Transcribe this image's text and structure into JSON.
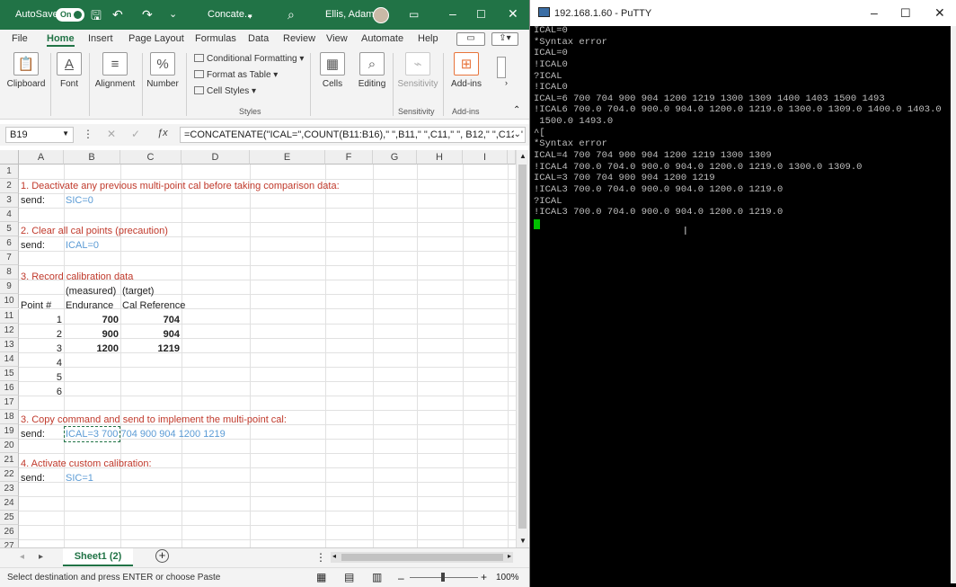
{
  "excel": {
    "titlebar": {
      "autosave_label": "AutoSave",
      "autosave_state": "On",
      "filename": "Concate...",
      "user": "Ellis, Adam"
    },
    "menu": [
      "File",
      "Home",
      "Insert",
      "Page Layout",
      "Formulas",
      "Data",
      "Review",
      "View",
      "Automate",
      "Help"
    ],
    "ribbon": {
      "clipboard": "Clipboard",
      "font": "Font",
      "alignment": "Alignment",
      "number": "Number",
      "cond_format": "Conditional Formatting",
      "format_table": "Format as Table",
      "cell_styles": "Cell Styles",
      "styles_group": "Styles",
      "cells": "Cells",
      "editing": "Editing",
      "sensitivity": "Sensitivity",
      "sensitivity_group": "Sensitivity",
      "addins": "Add-ins",
      "addins_group": "Add-ins"
    },
    "formula_bar": {
      "name_box": "B19",
      "formula": "=CONCATENATE(\"ICAL=\",COUNT(B11:B16),\" \",B11,\" \",C11,\" \", B12,\" \",C12,\""
    },
    "columns": [
      "A",
      "B",
      "C",
      "D",
      "E",
      "F",
      "G",
      "H",
      "I"
    ],
    "rows": [
      "1",
      "2",
      "3",
      "4",
      "5",
      "6",
      "7",
      "8",
      "9",
      "10",
      "11",
      "12",
      "13",
      "14",
      "15",
      "16",
      "17",
      "18",
      "19",
      "20",
      "21",
      "22",
      "23",
      "24",
      "25",
      "26",
      "27"
    ],
    "cells": {
      "r2": "1. Deactivate any previous multi-point cal before taking comparison data:",
      "r3a": "send:",
      "r3b": "SIC=0",
      "r5": "2. Clear all cal points (precaution)",
      "r6a": "send:",
      "r6b": "ICAL=0",
      "r8": "3. Record calibration data",
      "r9b": "(measured)",
      "r9c": "(target)",
      "r10a": "Point #",
      "r10b": "Endurance",
      "r10c": "Cal Reference",
      "r11": [
        "1",
        "700",
        "704"
      ],
      "r12": [
        "2",
        "900",
        "904"
      ],
      "r13": [
        "3",
        "1200",
        "1219"
      ],
      "r14": "4",
      "r15": "5",
      "r16": "6",
      "r18": "3. Copy command and send to implement the multi-point cal:",
      "r19a": "send:",
      "r19b": "ICAL=3 700 704 900 904 1200 1219",
      "r21": "4. Activate custom calibration:",
      "r22a": "send:",
      "r22b": "SIC=1"
    },
    "sheet_tab": "Sheet1 (2)",
    "status": "Select destination and press ENTER or choose Paste",
    "zoom": "100%"
  },
  "putty": {
    "title": "192.168.1.60 - PuTTY",
    "lines": [
      "ICAL=0",
      "*Syntax error",
      "ICAL=0",
      "!ICAL0",
      "?ICAL",
      "!ICAL0",
      "ICAL=6 700 704 900 904 1200 1219 1300 1309 1400 1403 1500 1493",
      "!ICAL6 700.0 704.0 900.0 904.0 1200.0 1219.0 1300.0 1309.0 1400.0 1403.0",
      " 1500.0 1493.0",
      "^[",
      "*Syntax error",
      "ICAL=4 700 704 900 904 1200 1219 1300 1309",
      "!ICAL4 700.0 704.0 900.0 904.0 1200.0 1219.0 1300.0 1309.0",
      "ICAL=3 700 704 900 904 1200 1219",
      "!ICAL3 700.0 704.0 900.0 904.0 1200.0 1219.0",
      "?ICAL",
      "!ICAL3 700.0 704.0 900.0 904.0 1200.0 1219.0"
    ]
  },
  "colors": {
    "excel_green": "#217346",
    "red_text": "#c0392b",
    "blue_text": "#5b9bd5",
    "terminal_bg": "#000000",
    "cursor": "#00c000"
  }
}
